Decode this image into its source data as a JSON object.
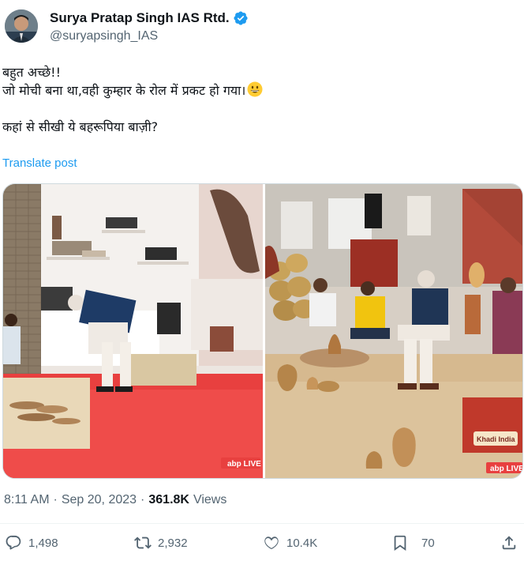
{
  "author": {
    "name": "Surya Pratap Singh IAS Rtd.",
    "handle": "@suryapsingh_IAS",
    "verified_icon": "verified-badge-icon",
    "verified_color": "#1d9bf0"
  },
  "tweet": {
    "lines": [
      "बहुत अच्छे!!",
      "जो मोची बना था,वही कुम्हार के रोल में प्रकट हो गया।",
      "",
      "कहां से सीखी ये बहरूपिया बाज़ी?"
    ],
    "emoji": "grinning-face-emoji",
    "translate_label": "Translate post"
  },
  "media": {
    "left_watermark": "abp LIVE",
    "right_watermark": "abp LIVE",
    "right_sign": "Khadi India"
  },
  "meta": {
    "time": "8:11 AM",
    "separator": "·",
    "date": "Sep 20, 2023",
    "views_count": "361.8K",
    "views_label": "Views"
  },
  "actions": {
    "reply_count": "1,498",
    "retweet_count": "2,932",
    "like_count": "10.4K",
    "bookmark_count": "70"
  },
  "colors": {
    "accent": "#1d9bf0",
    "text_secondary": "#536471",
    "text_primary": "#0f1419"
  }
}
